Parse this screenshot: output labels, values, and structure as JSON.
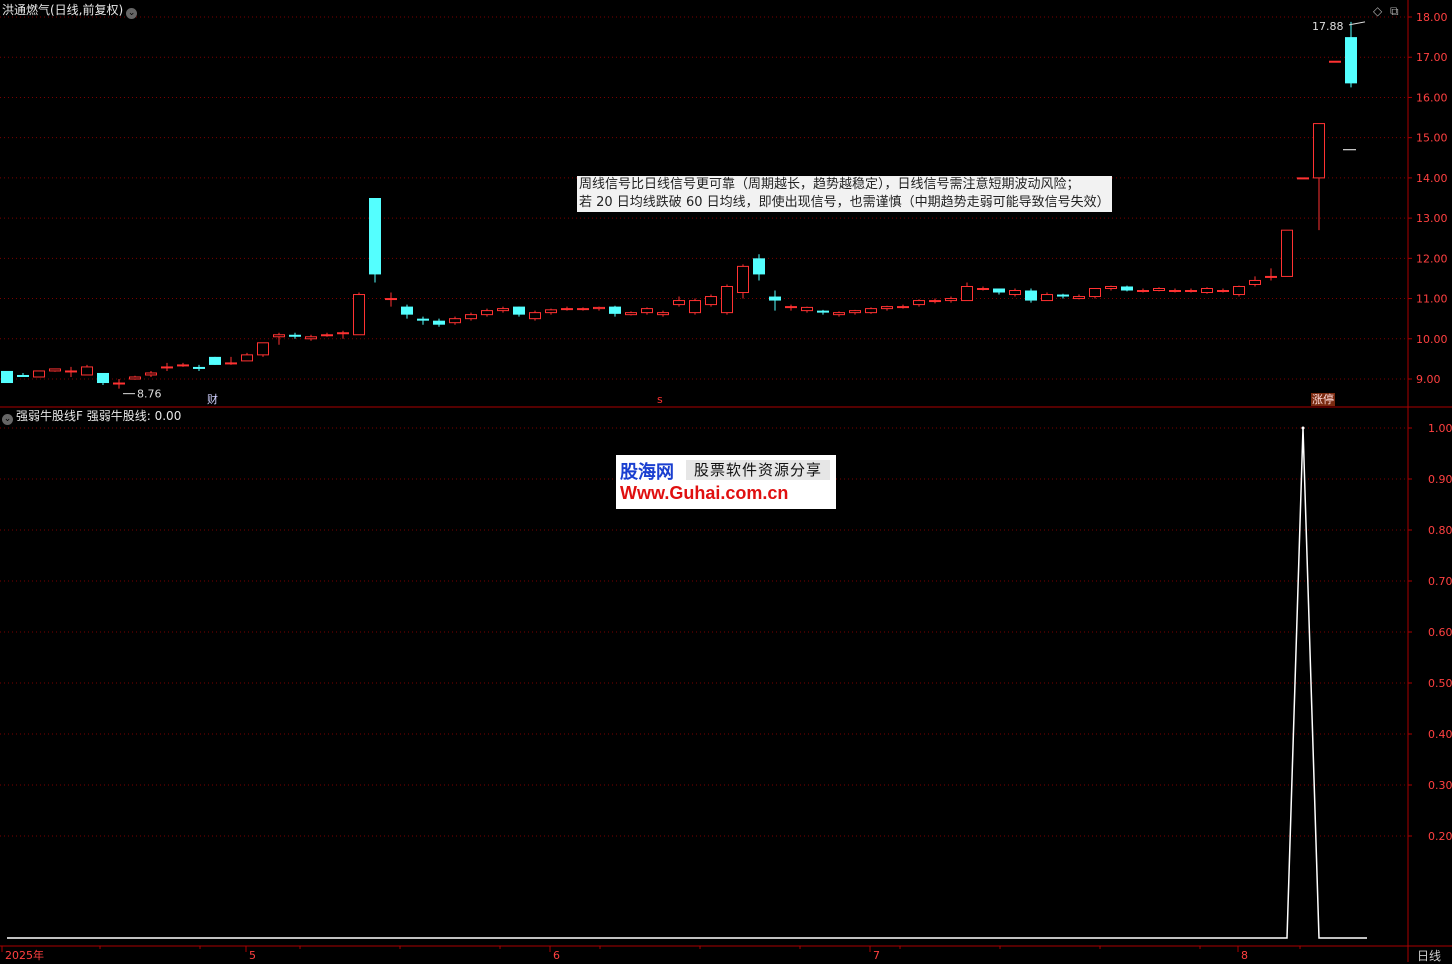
{
  "header": {
    "title": "洪通燃气(日线,前复权)",
    "indicator_title": "强弱牛股线F",
    "indicator_label": "强弱牛股线:",
    "indicator_value": "0.00",
    "period_label": "日线",
    "diamond_icon": "diamond-icon",
    "window_icon": "window-restore-icon"
  },
  "note": {
    "line1": "周线信号比日线信号更可靠（周期越长，趋势越稳定），日线信号需注意短期波动风险；",
    "line2": "若 20 日均线跌破 60 日均线，即使出现信号，也需谨慎（中期趋势走弱可能导致信号失效）"
  },
  "watermark": {
    "logo": "股海网",
    "tagline": "股票软件资源分享",
    "url": "Www.Guhai.com.cn"
  },
  "markers": {
    "cai": "财",
    "s": "s",
    "zhangting": "涨停",
    "high_label": "17.88",
    "low_label": "8.76"
  },
  "colors": {
    "up": "#ff3232",
    "down": "#54ffff",
    "grid": "#7a0000",
    "axis": "#aa0000",
    "indicator_line": "#ffffff"
  },
  "chart_data": [
    {
      "type": "candlestick",
      "title": "洪通燃气(日线,前复权)",
      "ylim": [
        9.0,
        18.0
      ],
      "yticks": [
        "18.00",
        "17.00",
        "16.00",
        "15.00",
        "14.00",
        "13.00",
        "12.00",
        "11.00",
        "10.00",
        "9.00"
      ],
      "x_month_labels": [
        "2025年",
        "5",
        "6",
        "7",
        "8"
      ],
      "ohlc": [
        [
          9.2,
          8.9,
          8.9,
          9.2
        ],
        [
          9.1,
          9.05,
          9.05,
          9.15
        ],
        [
          9.05,
          9.2,
          9.05,
          9.2
        ],
        [
          9.2,
          9.25,
          9.18,
          9.25
        ],
        [
          9.2,
          9.2,
          9.05,
          9.3
        ],
        [
          9.1,
          9.3,
          9.1,
          9.35
        ],
        [
          9.15,
          8.9,
          8.85,
          9.15
        ],
        [
          8.9,
          8.9,
          8.76,
          9.0
        ],
        [
          9.0,
          9.05,
          8.98,
          9.08
        ],
        [
          9.1,
          9.15,
          9.05,
          9.2
        ],
        [
          9.3,
          9.3,
          9.2,
          9.4
        ],
        [
          9.35,
          9.35,
          9.3,
          9.4
        ],
        [
          9.3,
          9.25,
          9.2,
          9.35
        ],
        [
          9.55,
          9.35,
          9.35,
          9.55
        ],
        [
          9.4,
          9.4,
          9.35,
          9.55
        ],
        [
          9.45,
          9.6,
          9.45,
          9.65
        ],
        [
          9.6,
          9.9,
          9.55,
          9.9
        ],
        [
          10.05,
          10.1,
          9.85,
          10.15
        ],
        [
          10.1,
          10.05,
          10.0,
          10.15
        ],
        [
          10.0,
          10.05,
          9.95,
          10.1
        ],
        [
          10.1,
          10.1,
          10.05,
          10.15
        ],
        [
          10.15,
          10.15,
          10.0,
          10.2
        ],
        [
          10.1,
          11.1,
          10.1,
          11.15
        ],
        [
          13.5,
          11.6,
          11.4,
          13.5
        ],
        [
          11.0,
          11.0,
          10.8,
          11.15
        ],
        [
          10.8,
          10.6,
          10.5,
          10.85
        ],
        [
          10.5,
          10.45,
          10.35,
          10.55
        ],
        [
          10.45,
          10.35,
          10.3,
          10.5
        ],
        [
          10.4,
          10.5,
          10.35,
          10.55
        ],
        [
          10.5,
          10.6,
          10.45,
          10.65
        ],
        [
          10.6,
          10.7,
          10.55,
          10.75
        ],
        [
          10.7,
          10.75,
          10.65,
          10.8
        ],
        [
          10.8,
          10.6,
          10.55,
          10.8
        ],
        [
          10.5,
          10.65,
          10.45,
          10.7
        ],
        [
          10.65,
          10.72,
          10.6,
          10.75
        ],
        [
          10.75,
          10.75,
          10.7,
          10.8
        ],
        [
          10.75,
          10.75,
          10.7,
          10.78
        ],
        [
          10.75,
          10.78,
          10.7,
          10.8
        ],
        [
          10.8,
          10.62,
          10.55,
          10.82
        ],
        [
          10.6,
          10.65,
          10.58,
          10.68
        ],
        [
          10.65,
          10.75,
          10.6,
          10.78
        ],
        [
          10.6,
          10.65,
          10.55,
          10.7
        ],
        [
          10.85,
          10.95,
          10.8,
          11.05
        ],
        [
          10.65,
          10.95,
          10.6,
          11.0
        ],
        [
          10.85,
          11.05,
          10.8,
          11.1
        ],
        [
          10.65,
          11.3,
          10.6,
          11.35
        ],
        [
          11.15,
          11.8,
          11.0,
          11.85
        ],
        [
          12.0,
          11.6,
          11.45,
          12.1
        ],
        [
          11.05,
          10.95,
          10.7,
          11.2
        ],
        [
          10.8,
          10.8,
          10.7,
          10.85
        ],
        [
          10.7,
          10.78,
          10.65,
          10.8
        ],
        [
          10.7,
          10.65,
          10.6,
          10.72
        ],
        [
          10.6,
          10.65,
          10.55,
          10.68
        ],
        [
          10.65,
          10.7,
          10.6,
          10.72
        ],
        [
          10.65,
          10.75,
          10.62,
          10.78
        ],
        [
          10.75,
          10.8,
          10.7,
          10.82
        ],
        [
          10.8,
          10.8,
          10.75,
          10.85
        ],
        [
          10.85,
          10.95,
          10.8,
          10.98
        ],
        [
          10.95,
          10.95,
          10.88,
          11.0
        ],
        [
          10.95,
          11.0,
          10.9,
          11.05
        ],
        [
          10.95,
          11.3,
          10.95,
          11.4
        ],
        [
          11.25,
          11.25,
          11.2,
          11.3
        ],
        [
          11.25,
          11.15,
          11.1,
          11.25
        ],
        [
          11.1,
          11.2,
          11.05,
          11.25
        ],
        [
          11.2,
          10.95,
          10.9,
          11.25
        ],
        [
          10.95,
          11.1,
          10.95,
          11.15
        ],
        [
          11.1,
          11.05,
          11.0,
          11.12
        ],
        [
          11.0,
          11.05,
          10.98,
          11.1
        ],
        [
          11.05,
          11.25,
          11.0,
          11.25
        ],
        [
          11.25,
          11.3,
          11.2,
          11.32
        ],
        [
          11.3,
          11.2,
          11.18,
          11.32
        ],
        [
          11.2,
          11.2,
          11.15,
          11.25
        ],
        [
          11.2,
          11.25,
          11.18,
          11.28
        ],
        [
          11.2,
          11.2,
          11.15,
          11.25
        ],
        [
          11.2,
          11.2,
          11.15,
          11.25
        ],
        [
          11.15,
          11.25,
          11.12,
          11.28
        ],
        [
          11.2,
          11.2,
          11.15,
          11.25
        ],
        [
          11.1,
          11.3,
          11.05,
          11.32
        ],
        [
          11.35,
          11.45,
          11.3,
          11.55
        ],
        [
          11.55,
          11.55,
          11.45,
          11.75
        ],
        [
          11.55,
          12.7,
          11.55,
          12.7
        ],
        [
          14.0,
          14.0,
          14.0,
          14.0
        ],
        [
          14.0,
          15.35,
          12.7,
          15.35
        ],
        [
          16.9,
          16.9,
          16.9,
          16.9
        ],
        [
          17.5,
          16.35,
          16.25,
          17.88
        ]
      ],
      "last_price": 14.7
    },
    {
      "type": "line",
      "title": "强弱牛股线F",
      "series": [
        {
          "name": "强弱牛股线",
          "values_description": "0 on all bars except 1.00 on bar index 81"
        }
      ],
      "values_nonzero": {
        "81": 1.0
      },
      "n": 86,
      "ylim": [
        0,
        1.0
      ],
      "yticks": [
        "1.00",
        "0.90",
        "0.80",
        "0.70",
        "0.60",
        "0.50",
        "0.40",
        "0.30",
        "0.20"
      ]
    }
  ]
}
